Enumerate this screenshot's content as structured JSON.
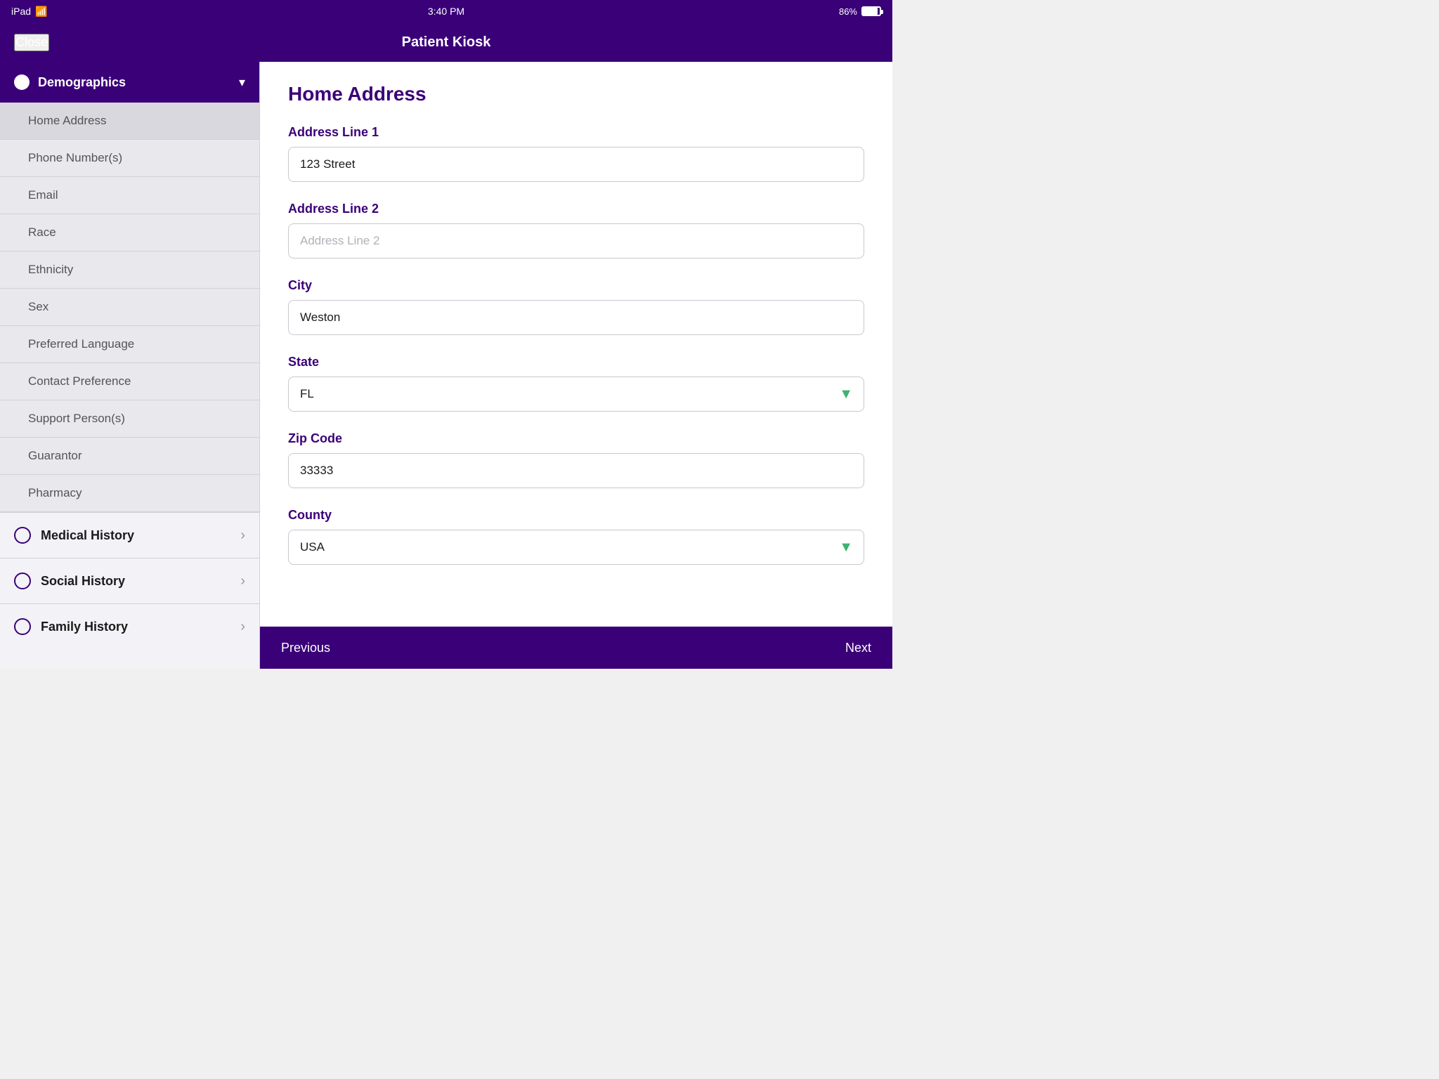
{
  "status_bar": {
    "device": "iPad",
    "wifi_icon": "wifi",
    "time": "3:40 PM",
    "battery_percent": "86%"
  },
  "nav": {
    "close_label": "Close",
    "title": "Patient Kiosk"
  },
  "sidebar": {
    "demographics_label": "Demographics",
    "demographics_chevron": "▾",
    "sub_items": [
      {
        "label": "Home Address",
        "active": true
      },
      {
        "label": "Phone Number(s)",
        "active": false
      },
      {
        "label": "Email",
        "active": false
      },
      {
        "label": "Race",
        "active": false
      },
      {
        "label": "Ethnicity",
        "active": false
      },
      {
        "label": "Sex",
        "active": false
      },
      {
        "label": "Preferred Language",
        "active": false
      },
      {
        "label": "Contact Preference",
        "active": false
      },
      {
        "label": "Support Person(s)",
        "active": false
      },
      {
        "label": "Guarantor",
        "active": false
      },
      {
        "label": "Pharmacy",
        "active": false
      }
    ],
    "nav_sections": [
      {
        "label": "Medical History",
        "key": "medical-history"
      },
      {
        "label": "Social History",
        "key": "social-history"
      },
      {
        "label": "Family History",
        "key": "family-history"
      }
    ]
  },
  "form": {
    "title": "Home Address",
    "fields": [
      {
        "key": "address_line_1",
        "label": "Address Line 1",
        "value": "123 Street",
        "placeholder": "",
        "type": "text",
        "has_dropdown": false
      },
      {
        "key": "address_line_2",
        "label": "Address Line 2",
        "value": "",
        "placeholder": "Address Line 2",
        "type": "text",
        "has_dropdown": false
      },
      {
        "key": "city",
        "label": "City",
        "value": "Weston",
        "placeholder": "",
        "type": "text",
        "has_dropdown": false
      },
      {
        "key": "state",
        "label": "State",
        "value": "FL",
        "placeholder": "",
        "type": "select",
        "has_dropdown": true
      },
      {
        "key": "zip_code",
        "label": "Zip Code",
        "value": "33333",
        "placeholder": "",
        "type": "text",
        "has_dropdown": false
      },
      {
        "key": "county",
        "label": "County",
        "value": "USA",
        "placeholder": "",
        "type": "select",
        "has_dropdown": true
      }
    ]
  },
  "bottom_bar": {
    "previous_label": "Previous",
    "next_label": "Next"
  },
  "icons": {
    "chevron_down": "▾",
    "chevron_right": "›",
    "dropdown_arrow": "▼"
  }
}
